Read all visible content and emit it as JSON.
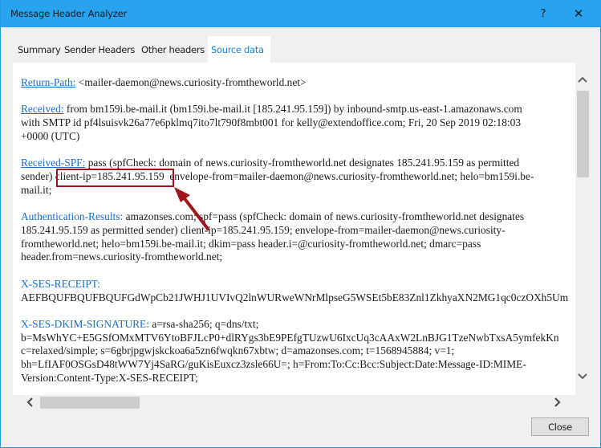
{
  "window": {
    "title": "Message Header Analyzer",
    "help_label": "?",
    "close_glyph": "✕"
  },
  "tabs": [
    {
      "label": "Summary",
      "active": false
    },
    {
      "label": "Sender Headers",
      "active": false
    },
    {
      "label": "Other headers",
      "active": false
    },
    {
      "label": "Source data",
      "active": true
    }
  ],
  "source_data": {
    "entries": [
      {
        "key": "Return-Path:",
        "lines": [
          "<mailer-daemon@news.curiosity-fromtheworld.net>"
        ]
      },
      {
        "key": "Received:",
        "lines": [
          "from bm159i.be-mail.it (bm159i.be-mail.it [185.241.95.159]) by inbound-smtp.us-east-1.amazonaws.com",
          "with SMTP id pf4lsuisvk26a77e6pklmq7ito7lt790f8mbt001 for kelly@extendoffice.com; Fri, 20 Sep 2019 02:18:03",
          "+0000 (UTC)"
        ]
      },
      {
        "key": "Received-SPF:",
        "lines": [
          "pass (spfCheck: domain of news.curiosity-fromtheworld.net designates 185.241.95.159 as permitted",
          "sender)",
          "client-ip=185.241.95.159",
          "envelope-from=mailer-daemon@news.curiosity-fromtheworld.net; helo=bm159i.be-",
          "mail.it;"
        ]
      },
      {
        "key": "Authentication-Results:",
        "lines": [
          "amazonses.com; spf=pass (spfCheck: domain of news.curiosity-fromtheworld.net designates",
          "185.241.95.159 as permitted sender) client-ip=185.241.95.159; envelope-from=mailer-daemon@news.curiosity-",
          "fromtheworld.net; helo=bm159i.be-mail.it; dkim=pass header.i=@curiosity-fromtheworld.net; dmarc=pass",
          "header.from=news.curiosity-fromtheworld.net;"
        ]
      },
      {
        "key": "X-SES-RECEIPT:",
        "lines": [
          "AEFBQUFBQUFBQUFGdWpCb21JWHJ1UVIvQ2lnWURweWNrMlpseG5WSEt5bE83Znl1ZkhyaXN2MG1qc0czOXh5Um"
        ]
      },
      {
        "key": "X-SES-DKIM-SIGNATURE:",
        "lines": [
          "a=rsa-sha256; q=dns/txt;",
          "b=MsWhYC+E5GSfOMxMTV6YtoBFJLcP0+dlRYgs3bE9PEfgTUzwU6IxcUq3cAAxW2LnBJG1TzeNwbTxsA5ymfekKn",
          "c=relaxed/simple; s=6gbrjpgwjskckoa6a5zn6fwqkn67xbtw; d=amazonses.com; t=1568945884; v=1;",
          "bh=LfIAF0OSGsD48tWW7Yj4SaRG/guKisEuxcz3zsle66U=; h=From:To:Cc:Bcc:Subject:Date:Message-ID:MIME-",
          "Version:Content-Type:X-SES-RECEIPT;"
        ]
      }
    ]
  },
  "annotation": {
    "highlighted_text": "client-ip=185.241.95.159",
    "color": "#a0141c"
  },
  "scrollbars": {
    "vertical": {
      "up_glyph": "︿",
      "down_glyph": "﹀",
      "position_fraction": 0.0
    },
    "horizontal": {
      "left_glyph": "❮",
      "right_glyph": "❯",
      "position_fraction": 0.0
    }
  },
  "footer": {
    "close_label": "Close"
  },
  "colors": {
    "titlebar": "#28a3f0",
    "link": "#1a6fcf",
    "active_tab_text": "#1a82d8"
  }
}
